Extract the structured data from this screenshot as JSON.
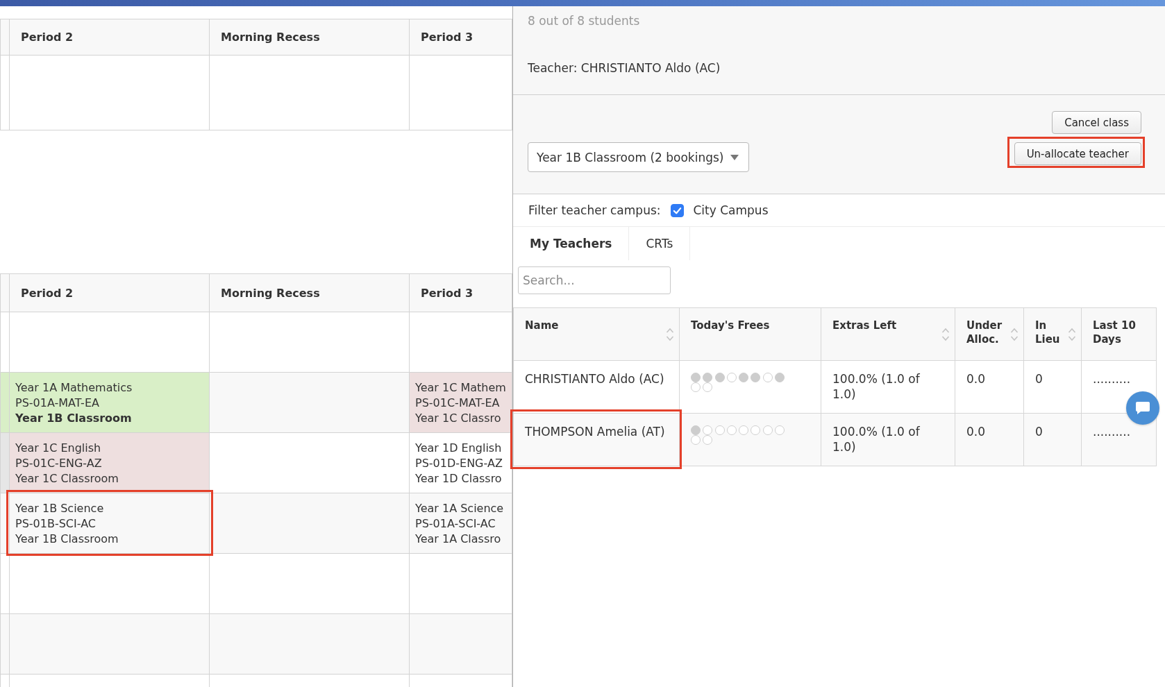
{
  "upper_timetable": {
    "columns": [
      "Period 2",
      "Morning Recess",
      "Period 3"
    ]
  },
  "lower_timetable": {
    "columns": [
      "Period 2",
      "Morning Recess",
      "Period 3"
    ],
    "rows": [
      {
        "cells": [
          {
            "kind": "plain"
          },
          {
            "kind": "plain"
          },
          {
            "kind": "plain"
          },
          {
            "kind": "plain"
          }
        ]
      },
      {
        "cells": [
          {
            "kind": "allocated"
          },
          {
            "kind": "allocated",
            "class": "Year 1A Mathematics",
            "code": "PS-01A-MAT-EA",
            "room": "Year 1B Classroom",
            "room_bold": true,
            "highlighted": false
          },
          {
            "kind": "plain"
          },
          {
            "kind": "clash",
            "class": "Year 1C Mathem",
            "code": "PS-01C-MAT-EA",
            "room": "Year 1C Classro",
            "room_bold": false,
            "highlighted": false
          }
        ]
      },
      {
        "cells": [
          {
            "kind": "unavailable"
          },
          {
            "kind": "clash",
            "class": "Year 1C English",
            "code": "PS-01C-ENG-AZ",
            "room": "Year 1C Classroom",
            "room_bold": false,
            "highlighted": false
          },
          {
            "kind": "plain"
          },
          {
            "kind": "plain",
            "class": "Year 1D English",
            "code": "PS-01D-ENG-AZ",
            "room": "Year 1D Classro",
            "room_bold": false,
            "highlighted": false
          }
        ]
      },
      {
        "cells": [
          {
            "kind": "plain"
          },
          {
            "kind": "plain",
            "class": "Year 1B Science",
            "code": "PS-01B-SCI-AC",
            "room": "Year 1B Classroom",
            "room_bold": false,
            "highlighted": true
          },
          {
            "kind": "plain"
          },
          {
            "kind": "plain",
            "class": "Year 1A Science",
            "code": "PS-01A-SCI-AC",
            "room": "Year 1A Classro",
            "room_bold": false,
            "highlighted": false
          }
        ]
      },
      {
        "cells": [
          {
            "kind": "plain"
          },
          {
            "kind": "plain"
          },
          {
            "kind": "plain"
          },
          {
            "kind": "plain"
          }
        ]
      },
      {
        "cells": [
          {
            "kind": "plain"
          },
          {
            "kind": "plain"
          },
          {
            "kind": "plain"
          },
          {
            "kind": "plain"
          }
        ]
      },
      {
        "cells": [
          {
            "kind": "plain"
          },
          {
            "kind": "plain"
          },
          {
            "kind": "plain"
          },
          {
            "kind": "plain"
          }
        ]
      }
    ]
  },
  "class_panel": {
    "student_count": "8 out of 8 students",
    "teacher": "Teacher: CHRISTIANTO Aldo (AC)",
    "room_select": {
      "value": "Year 1B Classroom (2 bookings)"
    },
    "buttons": [
      {
        "label": "Cancel class",
        "highlighted": false
      },
      {
        "label": "Un-allocate teacher",
        "highlighted": true
      }
    ]
  },
  "teacher_picker": {
    "campus_filter": {
      "label": "Filter teacher campus:",
      "checked": true,
      "option": "City Campus"
    },
    "tabs": [
      {
        "label": "My Teachers",
        "selected": true
      },
      {
        "label": "CRTs",
        "selected": false
      }
    ],
    "search": {
      "placeholder": "Search..."
    },
    "columns": [
      {
        "label": "Name",
        "sortable": true
      },
      {
        "label": "Today's Frees",
        "sortable": false
      },
      {
        "label": "Extras Left",
        "sortable": true
      },
      {
        "label": "Under Alloc.",
        "sortable": true
      },
      {
        "label": "In Lieu",
        "sortable": true
      },
      {
        "label": "Last 10 Days",
        "sortable": false
      }
    ],
    "rows": [
      {
        "name": "CHRISTIANTO Aldo (AC)",
        "highlighted": false,
        "slots": [
          {
            "filled": true
          },
          {
            "filled": true
          },
          {
            "filled": true
          },
          {
            "filled": false
          },
          {
            "filled": true
          },
          {
            "filled": true
          },
          {
            "filled": false
          },
          {
            "filled": true
          },
          {
            "filled": false
          },
          {
            "filled": false
          }
        ],
        "extras_left": "100.0% (1.0 of 1.0)",
        "under_alloc": "0.0",
        "in_lieu": "0",
        "last_10_days": ".........."
      },
      {
        "name": "THOMPSON Amelia (AT)",
        "highlighted": true,
        "slots": [
          {
            "filled": true
          },
          {
            "filled": false
          },
          {
            "filled": false
          },
          {
            "filled": false
          },
          {
            "filled": false
          },
          {
            "filled": false
          },
          {
            "filled": false
          },
          {
            "filled": false
          },
          {
            "filled": false
          },
          {
            "filled": false
          }
        ],
        "extras_left": "100.0% (1.0 of 1.0)",
        "under_alloc": "0.0",
        "in_lieu": "0",
        "last_10_days": ".........."
      }
    ]
  }
}
